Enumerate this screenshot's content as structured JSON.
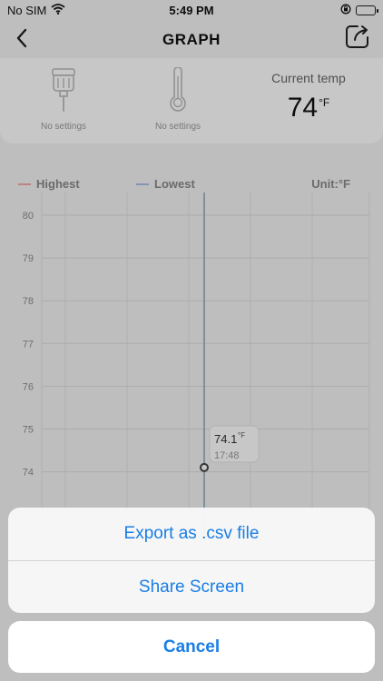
{
  "status_bar": {
    "carrier": "No SIM",
    "time": "5:49 PM",
    "icons": [
      "wifi-icon",
      "orientation-lock-icon",
      "battery-charging-icon"
    ],
    "battery_color": "#39c44a"
  },
  "nav": {
    "title": "GRAPH",
    "back_icon": "chevron-left-icon",
    "share_icon": "share-icon"
  },
  "settings": {
    "slot1": {
      "icon": "probe-icon",
      "label": "No settings"
    },
    "slot2": {
      "icon": "thermometer-icon",
      "label": "No settings"
    },
    "current": {
      "label": "Current temp",
      "value": "74",
      "unit": "°F"
    }
  },
  "legend": {
    "highest": "Highest",
    "lowest": "Lowest",
    "unit": "Unit:°F",
    "highest_color": "#f2a8a8",
    "lowest_color": "#a9bde6"
  },
  "chart_data": {
    "type": "line",
    "ylim": [
      73.4,
      80.5
    ],
    "y_ticks": [
      "80",
      "79",
      "78",
      "77",
      "76",
      "75",
      "74"
    ],
    "series": [
      {
        "name": "Highest",
        "values": []
      },
      {
        "name": "Lowest",
        "values": []
      }
    ],
    "cursor": {
      "value": "74.1",
      "unit": "°F",
      "time": "17:48",
      "y": 74.1
    },
    "grid": true
  },
  "sheet": {
    "export": "Export as .csv file",
    "share": "Share Screen",
    "cancel": "Cancel",
    "accent": "#1a7ee6"
  }
}
